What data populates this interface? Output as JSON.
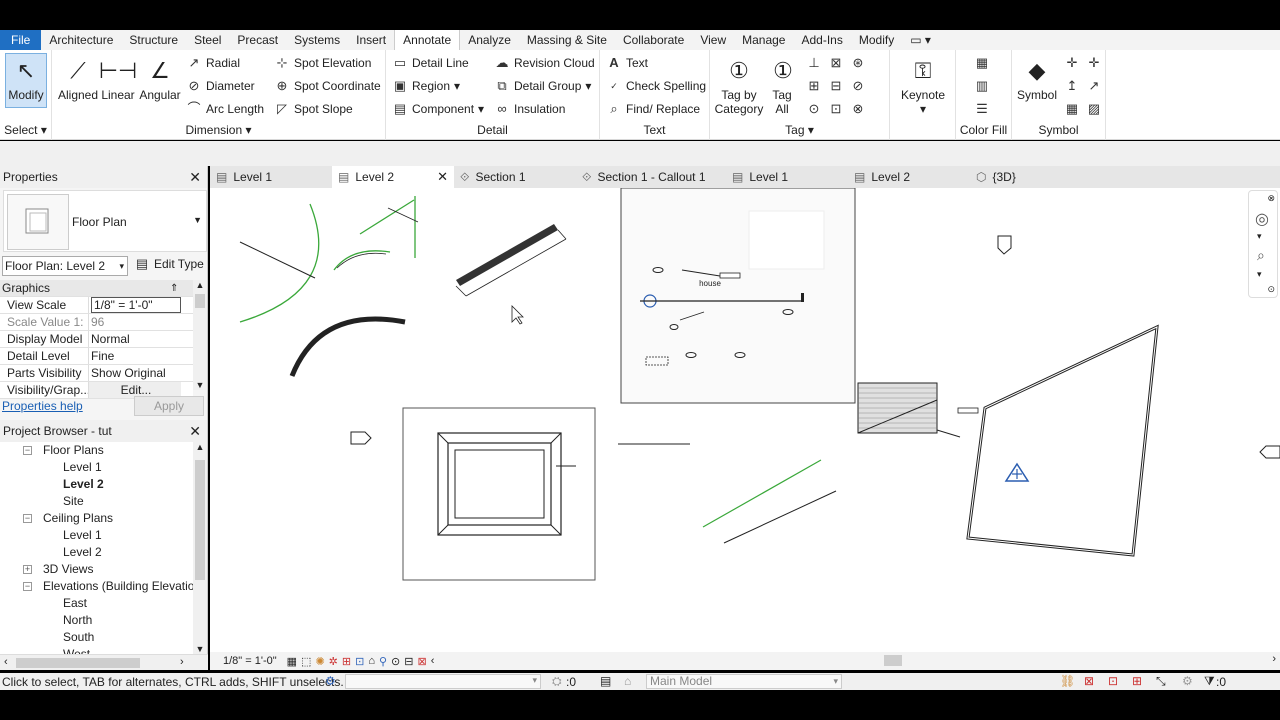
{
  "ribbon_tabs": [
    "File",
    "Architecture",
    "Structure",
    "Steel",
    "Precast",
    "Systems",
    "Insert",
    "Annotate",
    "Analyze",
    "Massing & Site",
    "Collaborate",
    "View",
    "Manage",
    "Add-Ins",
    "Modify"
  ],
  "active_tab": "Annotate",
  "select": {
    "modify": "Modify",
    "label": "Select"
  },
  "dimension": {
    "aligned": "Aligned",
    "linear": "Linear",
    "angular": "Angular",
    "radial": "Radial",
    "diameter": "Diameter",
    "arc_length": "Arc Length",
    "spot_elevation": "Spot Elevation",
    "spot_coordinate": "Spot Coordinate",
    "spot_slope": "Spot Slope",
    "label": "Dimension"
  },
  "detail": {
    "detail_line": "Detail Line",
    "region": "Region",
    "component": "Component",
    "revision_cloud": "Revision Cloud",
    "detail_group": "Detail Group",
    "insulation": "Insulation",
    "label": "Detail"
  },
  "text": {
    "text": "Text",
    "check_spelling": "Check Spelling",
    "find_replace": "Find/ Replace",
    "label": "Text"
  },
  "tag": {
    "by_category_1": "Tag by",
    "by_category_2": "Category",
    "all_1": "Tag",
    "all_2": "All",
    "label": "Tag"
  },
  "keynote": {
    "label": "Keynote"
  },
  "color_fill": {
    "label": "Color Fill"
  },
  "symbol": {
    "btn": "Symbol",
    "label": "Symbol"
  },
  "properties": {
    "title": "Properties",
    "type_name": "Floor Plan",
    "instance": "Floor Plan: Level 2",
    "edit_type": "Edit Type",
    "section": "Graphics",
    "rows": [
      {
        "k": "View Scale",
        "v": "1/8\" = 1'-0\""
      },
      {
        "k": "Scale Value    1:",
        "v": "96"
      },
      {
        "k": "Display Model",
        "v": "Normal"
      },
      {
        "k": "Detail Level",
        "v": "Fine"
      },
      {
        "k": "Parts Visibility",
        "v": "Show Original"
      },
      {
        "k": "Visibility/Grap...",
        "v": "Edit..."
      }
    ],
    "help": "Properties help",
    "apply": "Apply"
  },
  "browser": {
    "title": "Project Browser - tut",
    "nodes": [
      {
        "label": "Floor Plans",
        "level": 1,
        "exp": "−"
      },
      {
        "label": "Level 1",
        "level": 2
      },
      {
        "label": "Level 2",
        "level": 2,
        "bold": true
      },
      {
        "label": "Site",
        "level": 2
      },
      {
        "label": "Ceiling Plans",
        "level": 1,
        "exp": "−"
      },
      {
        "label": "Level 1",
        "level": 2
      },
      {
        "label": "Level 2",
        "level": 2
      },
      {
        "label": "3D Views",
        "level": 1,
        "exp": "+"
      },
      {
        "label": "Elevations (Building Elevation",
        "level": 1,
        "exp": "−"
      },
      {
        "label": "East",
        "level": 2
      },
      {
        "label": "North",
        "level": 2
      },
      {
        "label": "South",
        "level": 2
      },
      {
        "label": "West",
        "level": 2
      }
    ]
  },
  "view_tabs": [
    "Level 1",
    "Level 2",
    "Section 1",
    "Section 1 - Callout 1",
    "Level 1",
    "Level 2",
    "{3D}"
  ],
  "canvas_text": {
    "house": "house"
  },
  "view_scale": "1/8\" = 1'-0\"",
  "status": {
    "text": "Click to select, TAB for alternates, CTRL adds, SHIFT unselects.",
    "count": ":0",
    "model": "Main Model",
    "filter": ":0"
  }
}
